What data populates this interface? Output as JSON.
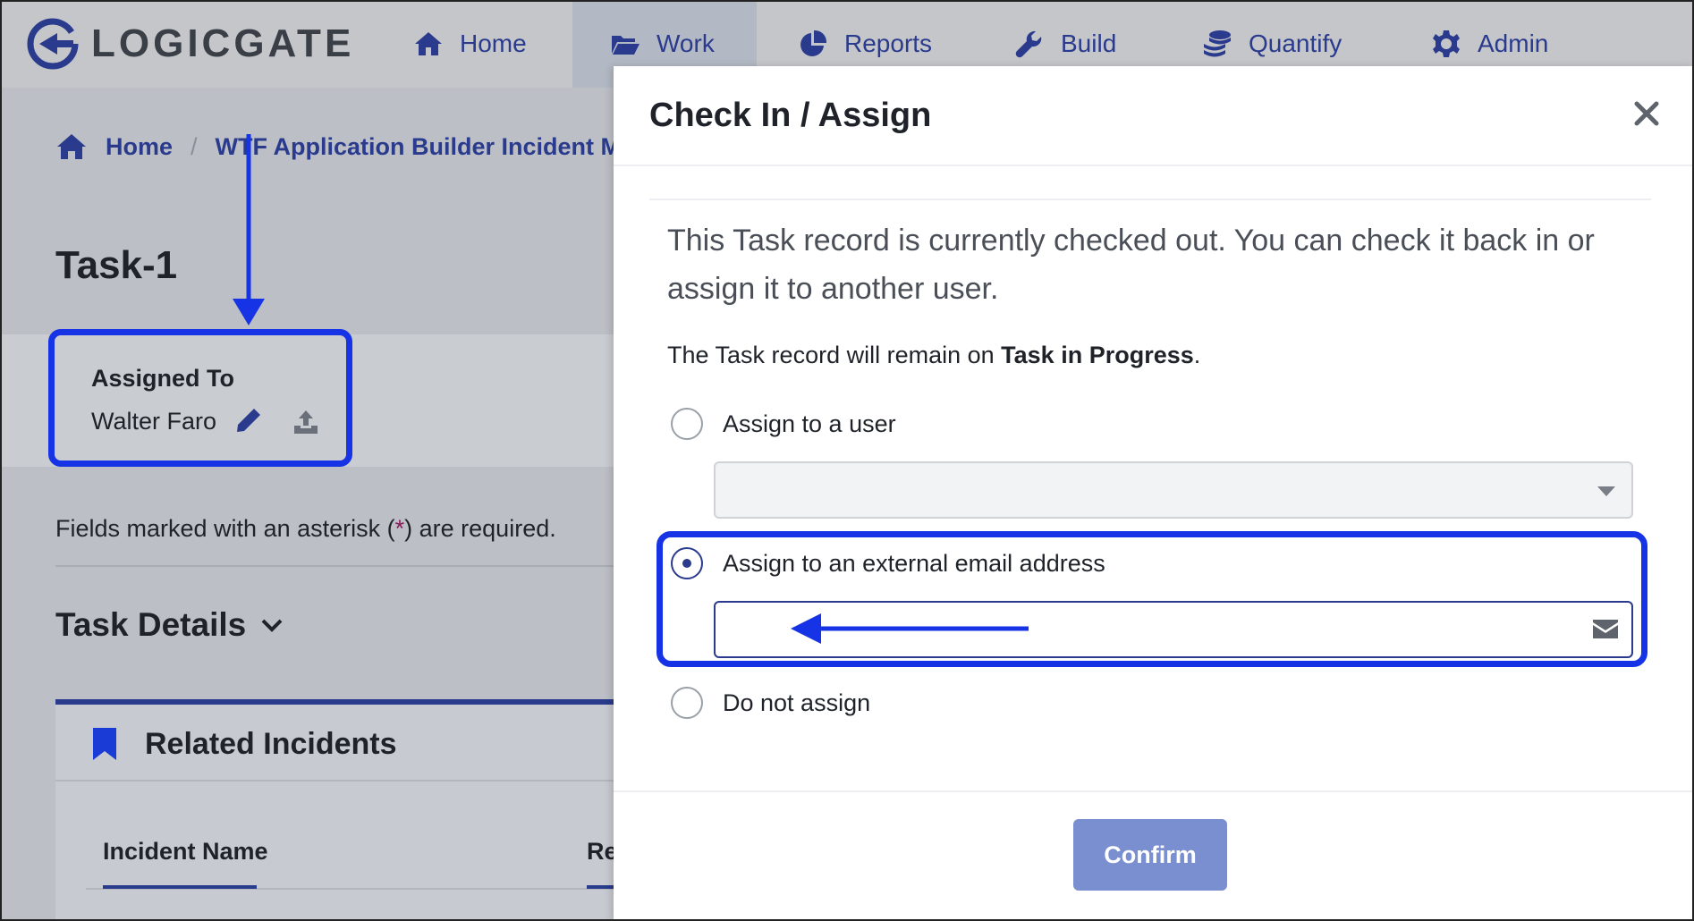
{
  "brand": {
    "name": "LOGICGATE"
  },
  "nav": {
    "items": [
      {
        "label": "Home",
        "icon": "home-icon"
      },
      {
        "label": "Work",
        "icon": "folder-open-icon",
        "active": true
      },
      {
        "label": "Reports",
        "icon": "pie-chart-icon"
      },
      {
        "label": "Build",
        "icon": "wrench-icon"
      },
      {
        "label": "Quantify",
        "icon": "coins-icon"
      },
      {
        "label": "Admin",
        "icon": "gear-icon"
      }
    ]
  },
  "breadcrumb": {
    "home": "Home",
    "separator": "/",
    "current": "WTF Application Builder Incident Mar"
  },
  "page": {
    "title": "Task-1",
    "assigned_to_label": "Assigned To",
    "assigned_to_value": "Walter Faro",
    "required_prefix": "Fields marked with an asterisk (",
    "required_asterisk": "*",
    "required_suffix": ") are required.",
    "section_title": "Task Details",
    "related_title": "Related Incidents",
    "col_incident_name": "Incident Name",
    "col_second": "Re"
  },
  "modal": {
    "title": "Check In / Assign",
    "message": "This Task record is currently checked out. You can check it back in or assign it to another user.",
    "remain_prefix": "The Task record will remain on ",
    "remain_step": "Task in Progress",
    "remain_suffix": ".",
    "options": [
      {
        "label": "Assign to a user",
        "checked": false
      },
      {
        "label": "Assign to an external email address",
        "checked": true
      },
      {
        "label": "Do not assign",
        "checked": false
      }
    ],
    "user_select_value": "",
    "email_value": "",
    "confirm_label": "Confirm"
  },
  "colors": {
    "accent": "#2a3a8c",
    "highlight": "#1633e6",
    "confirm_button": "#7a8fd0"
  }
}
